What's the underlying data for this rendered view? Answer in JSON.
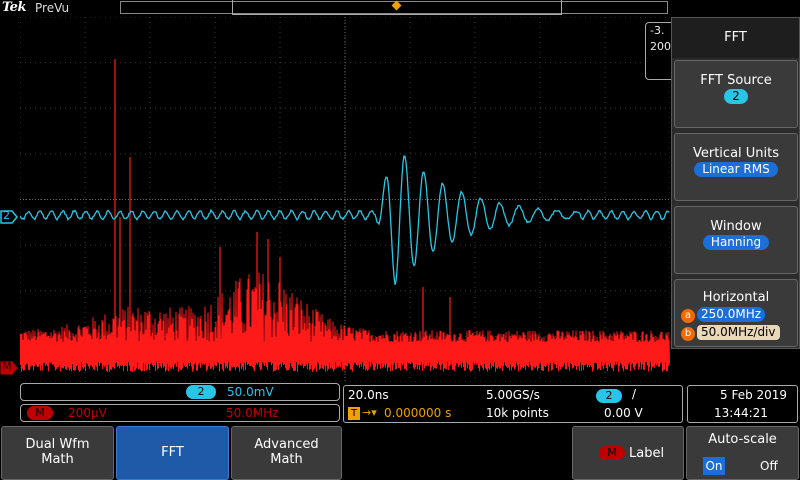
{
  "header": {
    "brand": "Tek",
    "mode": "PreVu"
  },
  "readout_top": {
    "line1": "-3.",
    "line2": "200"
  },
  "markers": {
    "ch2": "2",
    "math": "M"
  },
  "side_menu": {
    "title": "FFT",
    "items": [
      {
        "label": "FFT Source",
        "value": "2"
      },
      {
        "label": "Vertical Units",
        "value": "Linear RMS"
      },
      {
        "label": "Window",
        "value": "Hanning"
      },
      {
        "label": "Horizontal",
        "a_key": "a",
        "a_value": "250.0MHz",
        "b_key": "b",
        "b_value": "50.0MHz/div"
      }
    ]
  },
  "channel_readout": {
    "ch": "2",
    "scale": "50.0mV"
  },
  "math_readout": {
    "ch": "M",
    "scale": "200μV",
    "span": "50.0MHz"
  },
  "acquisition": {
    "timebase": "20.0ns",
    "sample_rate": "5.00GS/s",
    "trigger_ch": "2",
    "trigger_slope": "/",
    "trigger_position": "0.000000 s",
    "record_length": "10k points",
    "trigger_level": "0.00 V",
    "trigger_marker": "T"
  },
  "datetime": {
    "date": "5 Feb  2019",
    "time": "13:44:21"
  },
  "softkeys": {
    "dual": {
      "line1": "Dual Wfm",
      "line2": "Math"
    },
    "fft": "FFT",
    "advanced": {
      "line1": "Advanced",
      "line2": "Math"
    },
    "label_key": {
      "chip": "M",
      "text": "Label"
    },
    "autoscale": {
      "title": "Auto-scale",
      "on": "On",
      "off": "Off"
    }
  },
  "colors": {
    "ch2": "#29c5e6",
    "math": "#ff1a1a",
    "grid": "#555555",
    "accent": "#f0a000"
  }
}
